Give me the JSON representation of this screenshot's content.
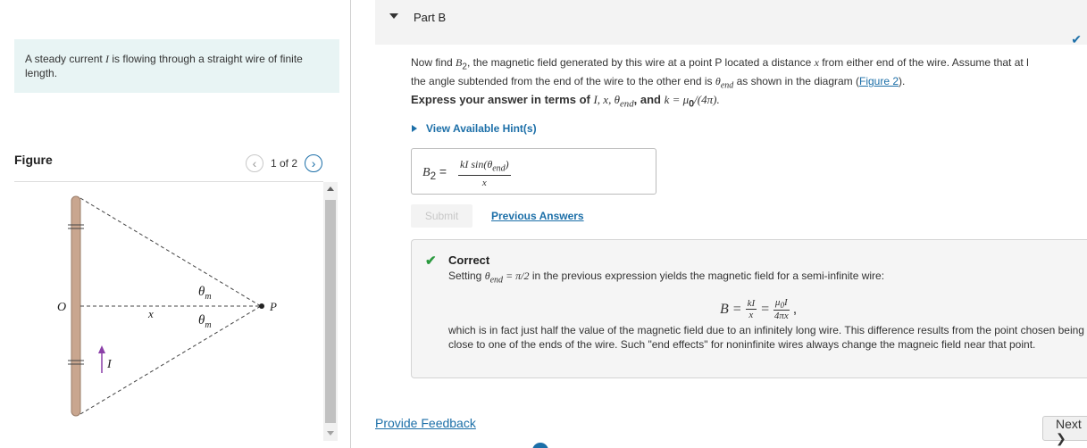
{
  "problem": {
    "intro_prefix": "A steady current ",
    "intro_var": "I",
    "intro_suffix": " is flowing through a straight wire of finite length."
  },
  "figure": {
    "heading": "Figure",
    "pager_text": "1 of 2",
    "labels": {
      "origin": "O",
      "x": "x",
      "theta_m_top": "θ",
      "theta_m_bottom": "θ",
      "theta_sub": "m",
      "point": "P",
      "current": "I"
    }
  },
  "part": {
    "title": "Part B",
    "question": {
      "t1": "Now find ",
      "b2_sym": "B",
      "b2_sub": "2",
      "t2": ", the magnetic field generated by this wire at a point P located a distance ",
      "x_sym": "x",
      "t3": " from either end of the wire. Assume that at l",
      "t4": "the angle subtended from the end of the wire to the other end is ",
      "theta_sym": "θ",
      "theta_sub": "end",
      "t5": " as shown in the diagram (",
      "figure_link": "Figure 2",
      "t6": ")."
    },
    "instruction": {
      "prefix": "Express your answer in terms of ",
      "vars": "I, x, θ",
      "vars_sub": "end",
      "middle": ", and ",
      "k_expr": "k = μ",
      "k_sub": "0",
      "k_tail": "/(4π).",
      "comma": ","
    },
    "hint_label": "View Available Hint(s)",
    "answer": {
      "lhs": "B",
      "lhs_sub": "2",
      "eq": " =",
      "numerator": "kI sin(θ",
      "numerator_sub": "end",
      "numerator_close": ")",
      "denominator": "x"
    },
    "submit_label": "Submit",
    "previous_answers_label": "Previous Answers",
    "feedback": {
      "status": "Correct",
      "line1_prefix": "Setting ",
      "line1_theta": "θ",
      "line1_sub": "end",
      "line1_expr": " = π/2",
      "line1_suffix": " in the previous expression yields the magnetic field for a semi-infinite wire:",
      "formula_lhs": "B =",
      "f1_num": "kI",
      "f1_den": "x",
      "eq2": "=",
      "f2_num": "μ",
      "f2_num_sub": "0",
      "f2_num_tail": "I",
      "f2_den": "4πx",
      "formula_tail": ",",
      "line2": "which is in fact just half the value of the magnetic field due to an infinitely long wire. This difference results from the point chosen being close to one of the ends of the wire. Such \"end effects\" for noninfinite wires always change the magneic field near that point."
    }
  },
  "footer": {
    "provide_feedback": "Provide Feedback",
    "next_label": "Next ❯"
  },
  "icons": {
    "pager_prev": "chevron-left-icon",
    "pager_next": "chevron-right-icon",
    "part_check": "check-icon",
    "correct_check": "check-icon"
  },
  "colors": {
    "accent": "#1c6fa8",
    "correct": "#2b9a3f",
    "intro_bg": "#e8f4f4",
    "wire": "#c9a68f",
    "current_arrow": "#8b3fa8"
  }
}
